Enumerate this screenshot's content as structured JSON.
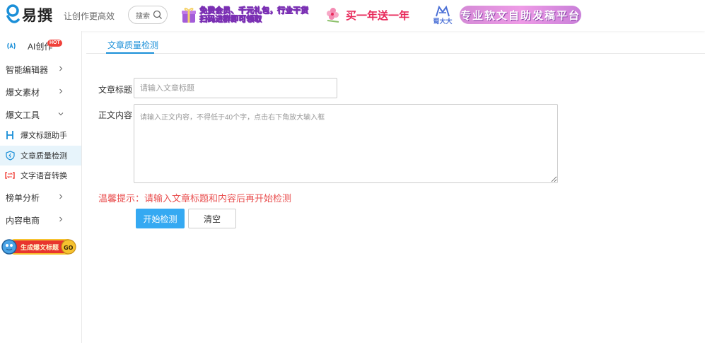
{
  "header": {
    "logo_text": "易撰",
    "slogan": "让创作更高效",
    "search": {
      "placeholder": "搜索"
    },
    "banners": {
      "promo1_line1": "免费会员、千元礼包，行业干货",
      "promo1_line2": "扫码进群即可领取",
      "promo2_text": "买一年送一年",
      "promo3_brand": "蜀大大",
      "promo3_text": "专业软文自助发稿平台"
    }
  },
  "sidebar": {
    "ai": {
      "label": "AI创作",
      "badge": "HOT"
    },
    "items": [
      {
        "label": "智能编辑器"
      },
      {
        "label": "爆文素材"
      },
      {
        "label": "爆文工具"
      },
      {
        "label": "榜单分析"
      },
      {
        "label": "内容电商"
      }
    ],
    "subitems": [
      {
        "label": "爆文标题助手"
      },
      {
        "label": "文章质量检测"
      },
      {
        "label": "文字语音转换"
      }
    ],
    "promo": {
      "text": "生成爆文标题",
      "go": "GO"
    }
  },
  "main": {
    "tab": "文章质量检测",
    "title_label": "文章标题",
    "title_placeholder": "请输入文章标题",
    "content_label": "正文内容",
    "content_placeholder": "请输入正文内容，不得低于40个字，点击右下角放大输入框",
    "tip": "温馨提示：请输入文章标题和内容后再开始检测",
    "start_button": "开始检测",
    "clear_button": "清空"
  },
  "colors": {
    "accent": "#1a8fd8",
    "primary_button": "#35a9f2",
    "tip_red": "#e94f4f",
    "hot_badge": "#f0413a",
    "active_bg": "#e7f4fb"
  },
  "icons": [
    "logo-icon",
    "search-icon",
    "gift-icon",
    "flower-icon",
    "brand-icon",
    "ai-icon",
    "chevron-right-icon",
    "chevron-down-icon",
    "heading-icon",
    "shield-icon",
    "convert-icon"
  ]
}
